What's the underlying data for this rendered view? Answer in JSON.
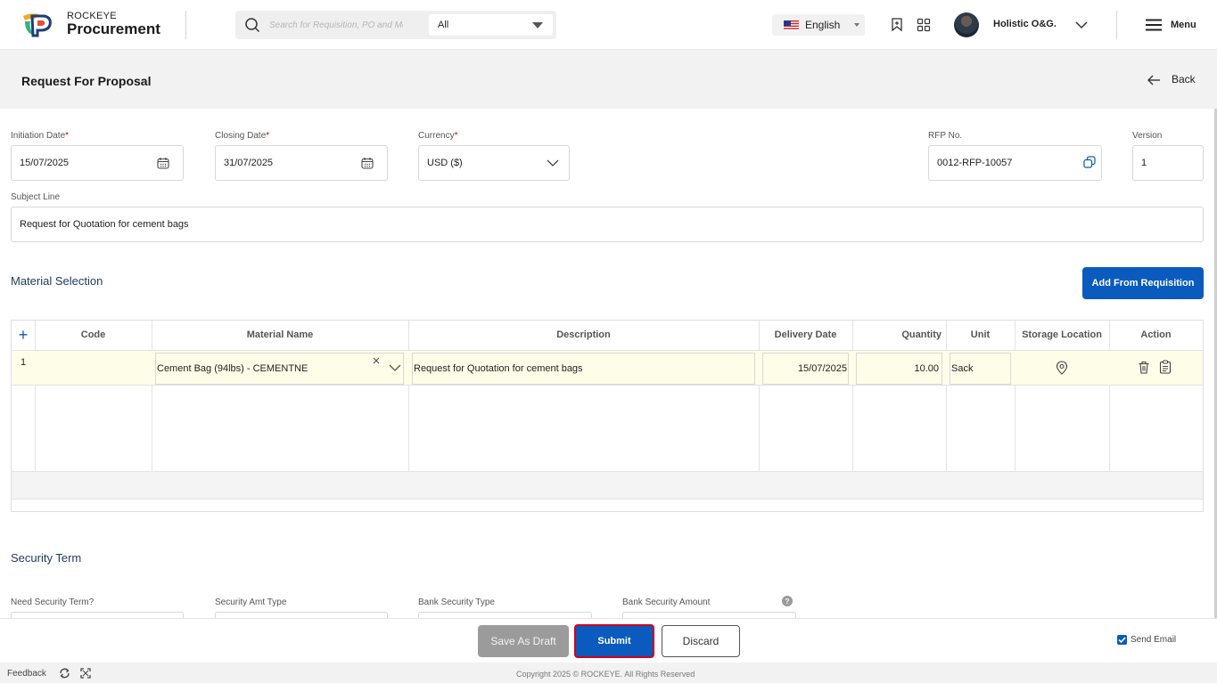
{
  "header": {
    "brand_small": "ROCKEYE",
    "brand_big": "Procurement",
    "search_placeholder": "Search for Requisition, PO and Mc",
    "search_scope": "All",
    "language": "English",
    "user_name": "Holistic O&G.",
    "menu_label": "Menu"
  },
  "page": {
    "title": "Request For Proposal",
    "back_label": "Back"
  },
  "form": {
    "initiation_date": {
      "label": "Initiation Date",
      "required": "*",
      "value": "15/07/2025"
    },
    "closing_date": {
      "label": "Closing Date",
      "required": "*",
      "value": "31/07/2025"
    },
    "currency": {
      "label": "Currency",
      "required": "*",
      "value": "USD ($)"
    },
    "rfp_no": {
      "label": "RFP No.",
      "value": "0012-RFP-10057"
    },
    "version": {
      "label": "Version",
      "value": "1"
    },
    "subject_line": {
      "label": "Subject Line",
      "value": "Request for Quotation for cement bags"
    }
  },
  "material": {
    "section_title": "Material Selection",
    "add_button": "Add From Requisition",
    "columns": {
      "add": "+",
      "code": "Code",
      "material_name": "Material Name",
      "description": "Description",
      "delivery_date": "Delivery Date",
      "quantity": "Quantity",
      "unit": "Unit",
      "storage_location": "Storage Location",
      "action": "Action"
    },
    "rows": [
      {
        "index": "1",
        "code": "",
        "material_name": "Cement Bag (94lbs) - CEMENTNE",
        "description": "Request for Quotation for cement bags",
        "delivery_date": "15/07/2025",
        "quantity": "10.00",
        "unit": "Sack"
      }
    ]
  },
  "security": {
    "section_title": "Security Term",
    "need_security_term": "Need Security Term?",
    "security_amt_type": "Security Amt Type",
    "bank_security_type": "Bank Security Type",
    "bank_security_amount": "Bank Security Amount"
  },
  "actions": {
    "save_draft": "Save As Draft",
    "submit": "Submit",
    "discard": "Discard",
    "send_email": "Send Email",
    "send_email_checked": true
  },
  "footer": {
    "feedback": "Feedback",
    "copyright": "Copyright 2025 © ROCKEYE. All Rights Reserved"
  },
  "colors": {
    "primary": "#0a5bbd",
    "submit_outline": "#d0021b",
    "row_highlight": "#fdfde8",
    "draft_button": "#9b9b9b"
  }
}
